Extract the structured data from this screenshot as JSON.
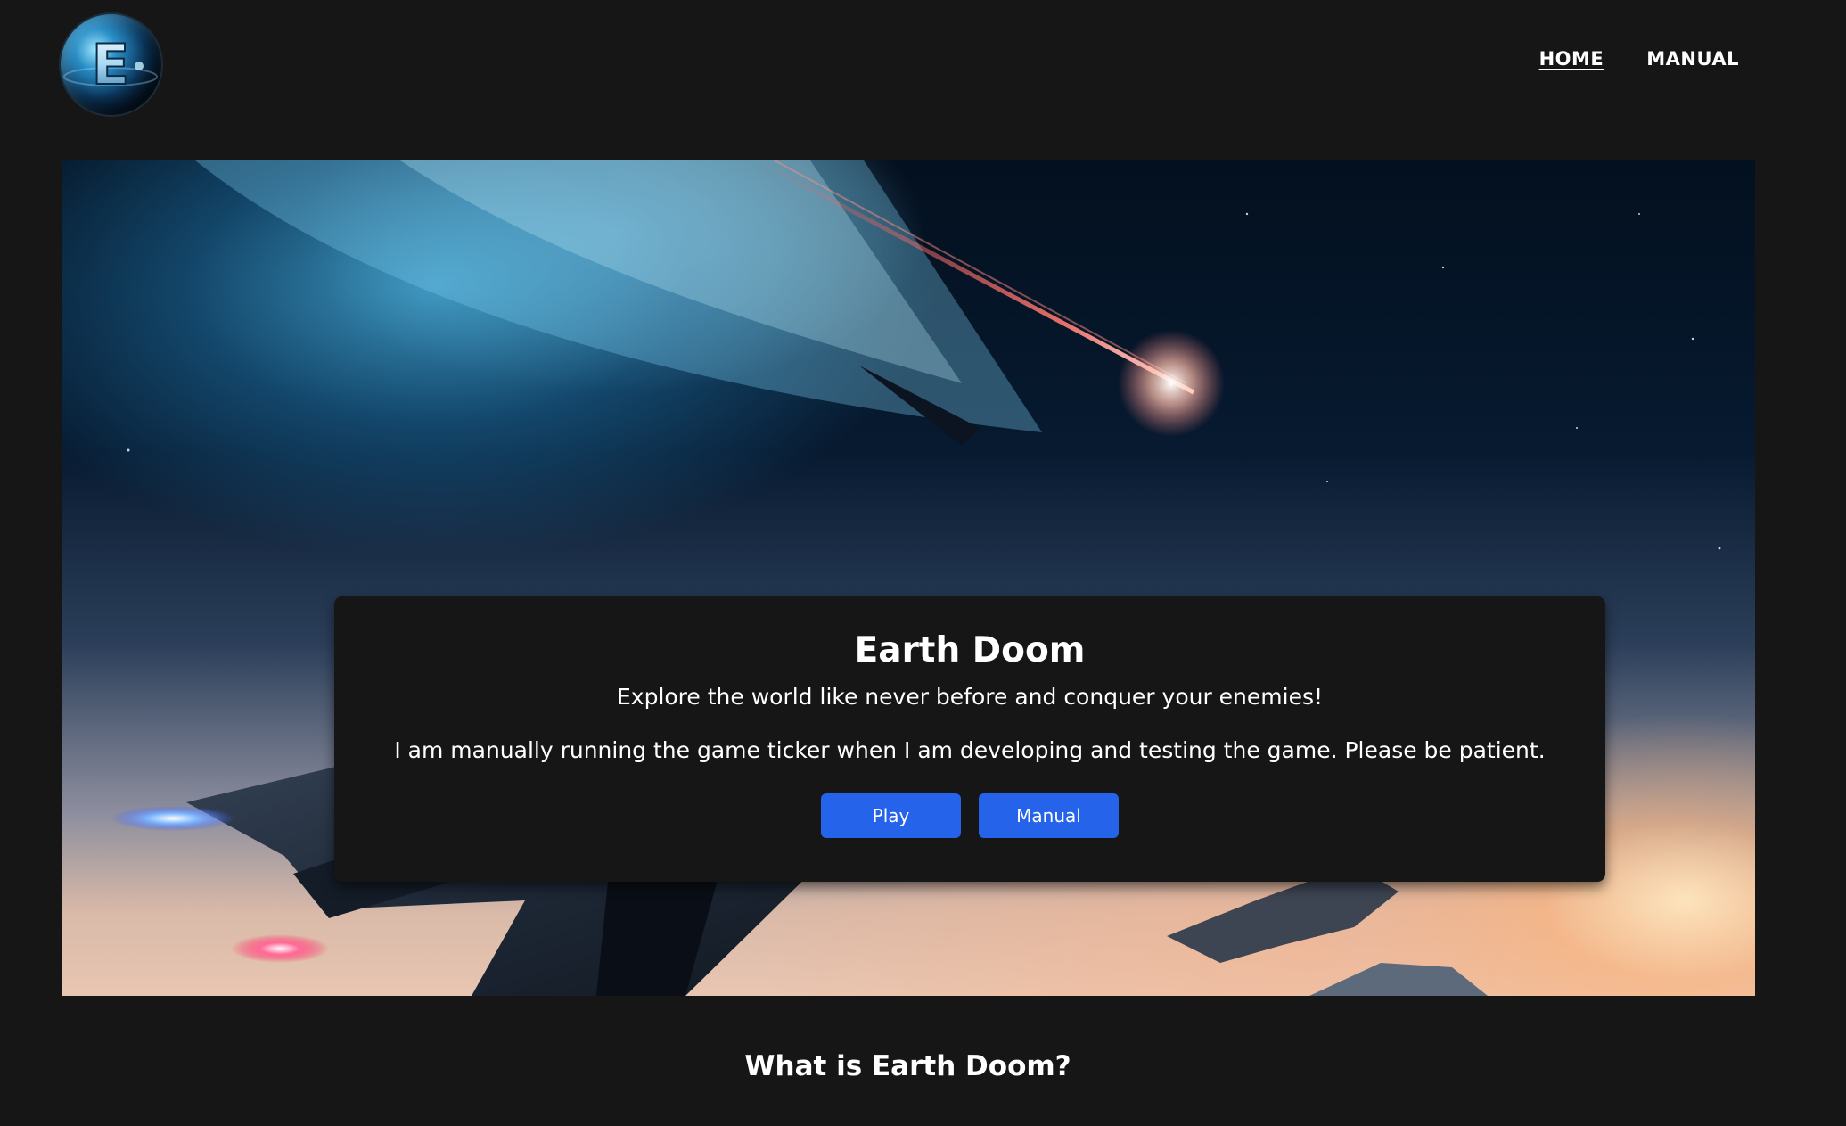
{
  "header": {
    "logo_letter": "E",
    "nav": [
      {
        "label": "HOME",
        "active": true
      },
      {
        "label": "MANUAL",
        "active": false
      }
    ]
  },
  "hero": {
    "title": "Earth Doom",
    "subtitle": "Explore the world like never before and conquer your enemies!",
    "note": "I am manually running the game ticker when I am developing and testing the game. Please be patient.",
    "buttons": {
      "play_label": "Play",
      "manual_label": "Manual"
    }
  },
  "section": {
    "title": "What is Earth Doom?"
  },
  "colors": {
    "page_background": "#161616",
    "card_background": "#161616",
    "button_primary": "#2563eb",
    "text": "#ffffff"
  }
}
